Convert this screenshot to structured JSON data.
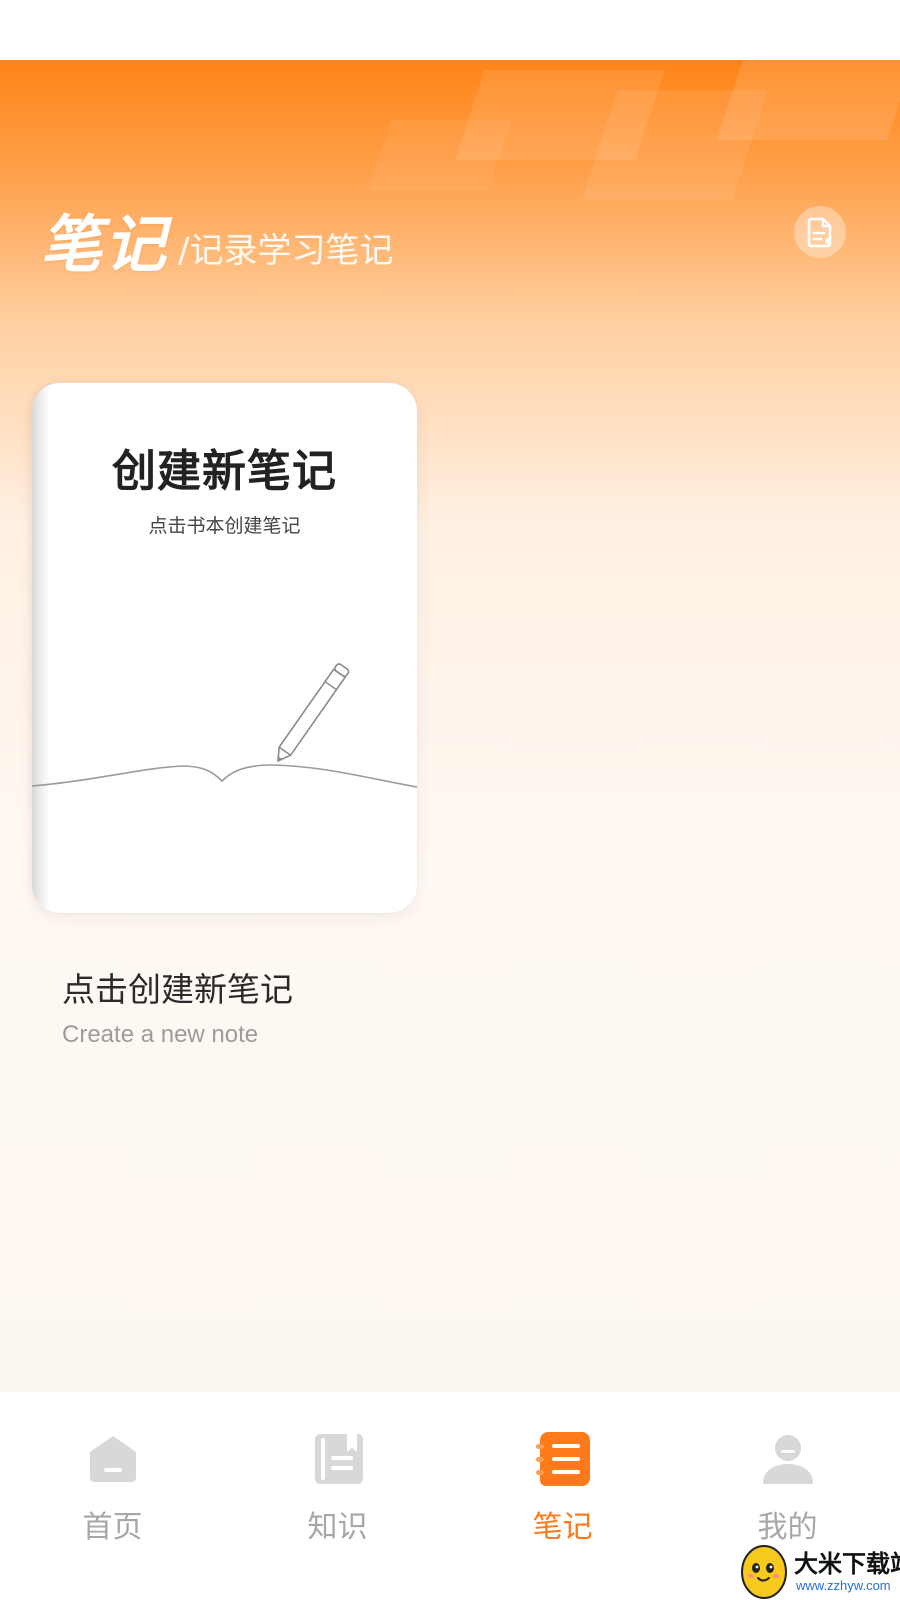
{
  "header": {
    "title": "笔记",
    "subtitle": "/记录学习笔记",
    "action_icon": "document-icon"
  },
  "card": {
    "book_title": "创建新笔记",
    "book_subtitle": "点击书本创建笔记",
    "caption": "点击创建新笔记",
    "caption_en": "Create a new note"
  },
  "tabs": [
    {
      "label": "首页",
      "icon": "home-icon",
      "active": false
    },
    {
      "label": "知识",
      "icon": "book-icon",
      "active": false
    },
    {
      "label": "笔记",
      "icon": "notebook-icon",
      "active": true
    },
    {
      "label": "我的",
      "icon": "user-icon",
      "active": false
    }
  ],
  "watermark": {
    "text": "大米下载站",
    "url": "www.zzhyw.com"
  },
  "colors": {
    "accent": "#ff7a1a",
    "header_top": "#ff8417",
    "tab_inactive": "#a7a7a7"
  }
}
